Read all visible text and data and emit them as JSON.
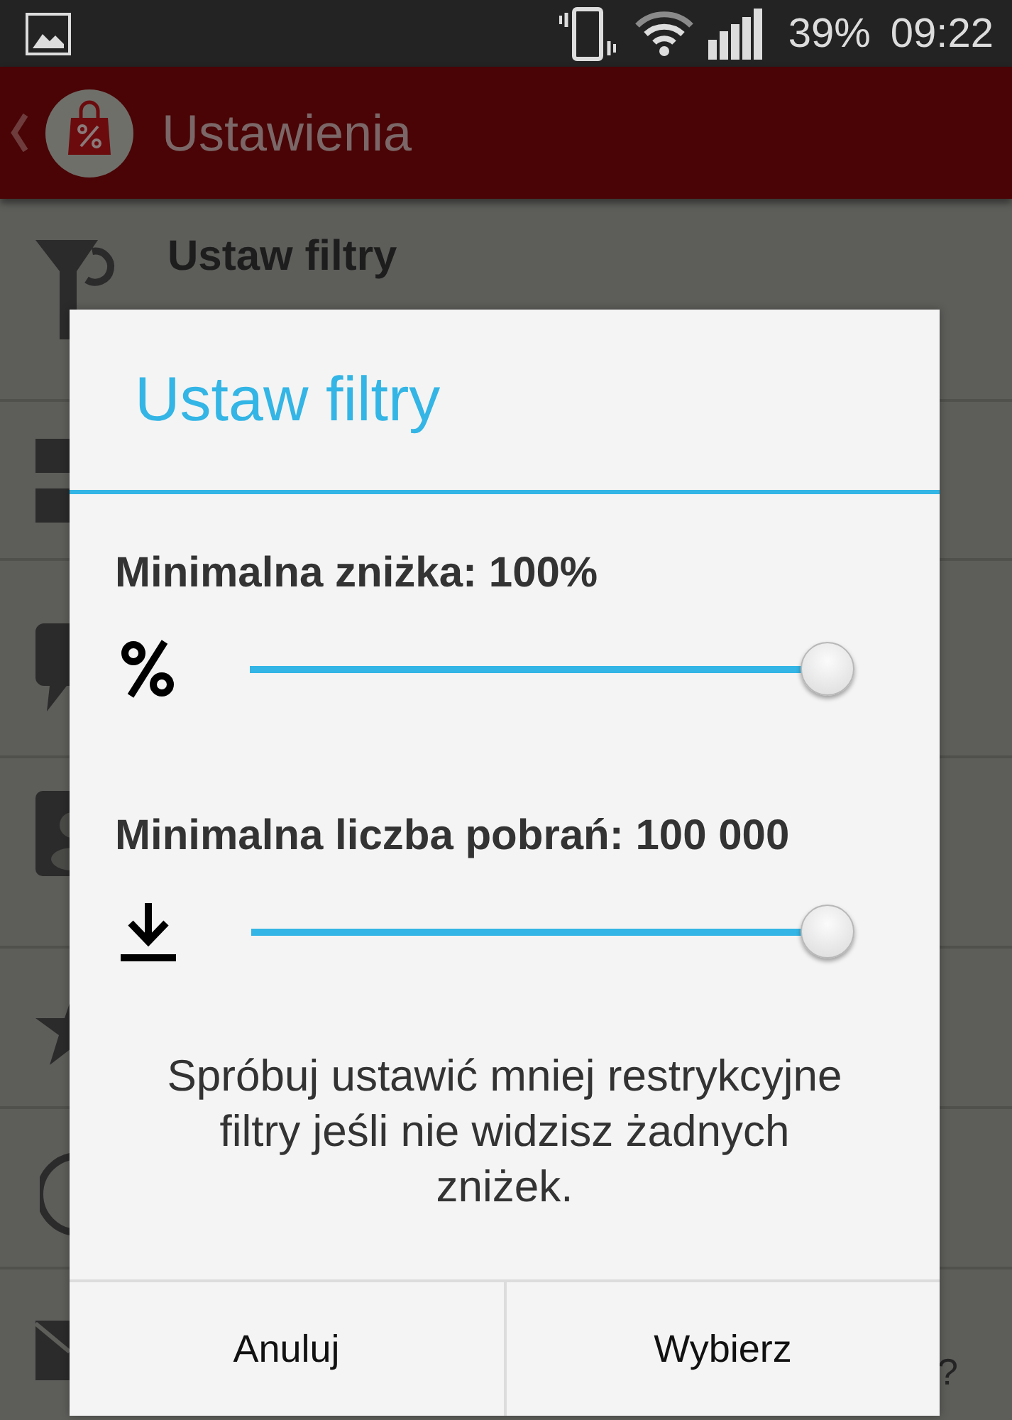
{
  "status_bar": {
    "battery": "39%",
    "time": "09:22"
  },
  "app_bar": {
    "title": "Ustawienia"
  },
  "settings_list": [
    {
      "kind": "filter",
      "title": "Ustaw filtry"
    },
    {
      "kind": "blocks"
    },
    {
      "kind": "bubble"
    },
    {
      "kind": "card"
    },
    {
      "kind": "star"
    },
    {
      "kind": "ring"
    },
    {
      "kind": "envelope",
      "trailing": "?"
    }
  ],
  "dialog": {
    "title": "Ustaw filtry",
    "sliders": [
      {
        "kind": "percent",
        "label": "Minimalna zniżka: 100%",
        "level": 1
      },
      {
        "kind": "download",
        "label": "Minimalna liczba pobrań: 100 000",
        "level": 1
      }
    ],
    "message": "Spróbuj ustawić mniej restrykcyjne filtry jeśli nie widzisz żadnych zniżek.",
    "buttons": [
      "Anuluj",
      "Wybierz"
    ]
  }
}
